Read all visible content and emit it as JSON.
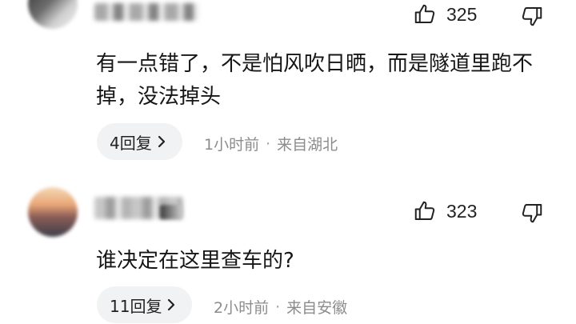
{
  "comments": [
    {
      "likes": "325",
      "text": "有一点错了，不是怕风吹日晒，而是隧道里跑不掉，没法掉头",
      "reply_label": "4回复",
      "time": "1小时前",
      "separator": "·",
      "location": "来自湖北"
    },
    {
      "likes": "323",
      "text": "谁决定在这里查车的?",
      "reply_label": "11回复",
      "time": "2小时前",
      "separator": "·",
      "location": "来自安徽"
    }
  ],
  "icons": {
    "like": "thumbs-up-icon",
    "dislike": "thumbs-down-icon",
    "chevron": "chevron-right-icon"
  },
  "colors": {
    "text": "#161616",
    "meta": "#8c8c8c",
    "reply_bg": "#f1f2f4"
  }
}
